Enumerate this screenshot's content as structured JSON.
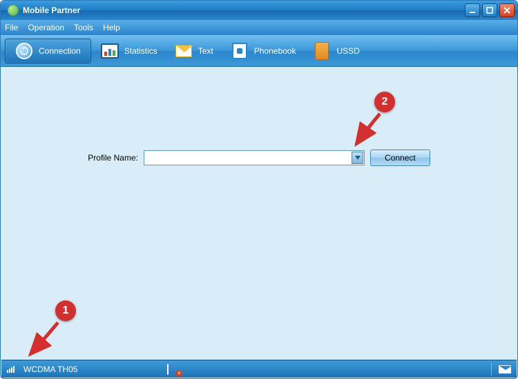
{
  "window": {
    "title": "Mobile Partner"
  },
  "menu": {
    "file": "File",
    "operation": "Operation",
    "tools": "Tools",
    "help": "Help"
  },
  "toolbar": {
    "connection": "Connection",
    "statistics": "Statistics",
    "text": "Text",
    "phonebook": "Phonebook",
    "ussd": "USSD"
  },
  "main": {
    "profile_label": "Profile Name:",
    "profile_value": "",
    "connect_label": "Connect"
  },
  "status": {
    "network": "WCDMA  TH05"
  },
  "annotations": {
    "c1": "1",
    "c2": "2"
  }
}
